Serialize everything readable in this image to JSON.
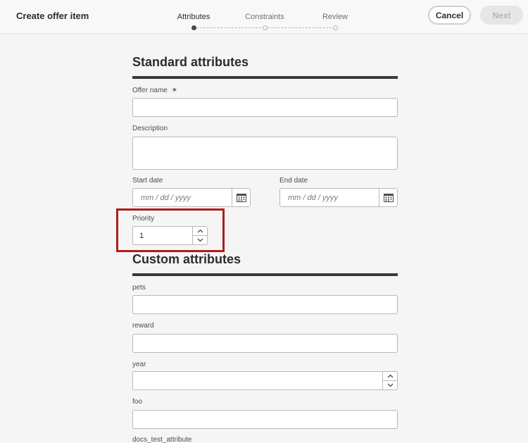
{
  "header": {
    "title": "Create offer item",
    "steps": [
      {
        "label": "Attributes",
        "active": true
      },
      {
        "label": "Constraints",
        "active": false
      },
      {
        "label": "Review",
        "active": false
      }
    ],
    "cancel_label": "Cancel",
    "next_label": "Next"
  },
  "standard": {
    "title": "Standard attributes",
    "offer_name_label": "Offer name",
    "required_mark": "✶",
    "description_label": "Description",
    "start_date_label": "Start date",
    "start_date_placeholder": "mm / dd /  yyyy",
    "end_date_label": "End date",
    "end_date_placeholder": "mm / dd /  yyyy",
    "priority_label": "Priority",
    "priority_value": "1"
  },
  "custom": {
    "title": "Custom attributes",
    "pets_label": "pets",
    "reward_label": "reward",
    "year_label": "year",
    "foo_label": "foo",
    "docs_label": "docs_test_attribute"
  },
  "icons": {
    "calendar": "calendar-icon",
    "chevron_up": "chevron-up-icon",
    "chevron_down": "chevron-down-icon"
  },
  "colors": {
    "highlight": "#b01c1c",
    "rule": "#3a3a3a"
  }
}
